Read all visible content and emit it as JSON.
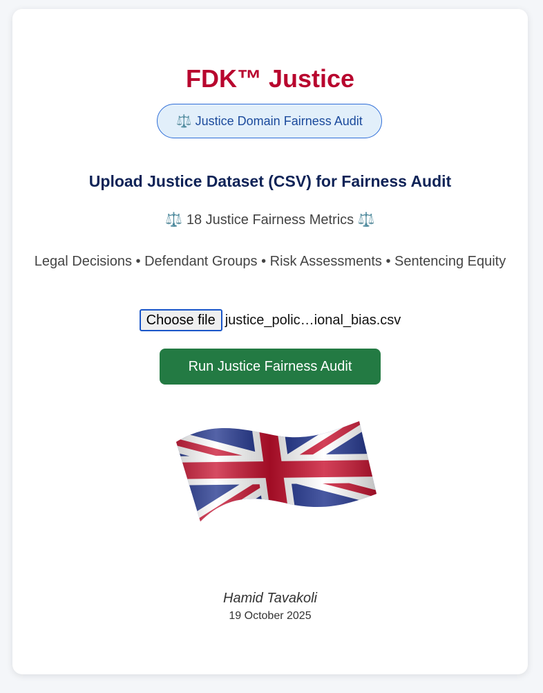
{
  "header": {
    "title": "FDK™ Justice",
    "badge": "⚖️ Justice Domain Fairness Audit"
  },
  "upload": {
    "heading": "Upload Justice Dataset (CSV) for Fairness Audit",
    "metrics_line": "⚖️ 18 Justice Fairness Metrics ⚖️",
    "categories_line": "Legal Decisions • Defendant Groups • Risk Assessments • Sentencing Equity",
    "choose_file_label": "Choose file",
    "selected_file": "justice_polic…ional_bias.csv",
    "run_button_label": "Run Justice Fairness Audit"
  },
  "flag": {
    "icon": "uk-flag-icon"
  },
  "footer": {
    "author": "Hamid Tavakoli",
    "date": "19 October 2025"
  },
  "colors": {
    "title": "#b8062e",
    "badge_bg": "#e2effa",
    "badge_border": "#2f6ed8",
    "heading": "#0f2357",
    "run_button": "#237a43",
    "page_bg": "#f4f6f9"
  }
}
